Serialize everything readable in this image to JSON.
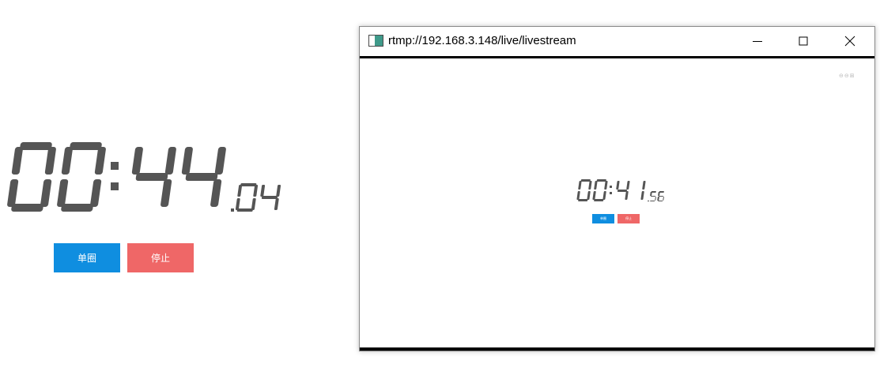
{
  "main_clock": {
    "minutes": "00",
    "seconds": "44",
    "hundredths": "04"
  },
  "buttons": {
    "lap_label": "单圈",
    "stop_label": "停止"
  },
  "player_window": {
    "title": "rtmp://192.168.3.148/live/livestream",
    "controls": [
      "minimize-icon",
      "maximize-icon",
      "close-icon"
    ],
    "stream_clock": {
      "minutes": "00",
      "seconds": "41",
      "hundredths": "56"
    },
    "stream_buttons": {
      "lap_label": "单圈",
      "stop_label": "停止"
    },
    "overlay_icons": "⊖⊖⊞"
  },
  "colors": {
    "digit": "#555555",
    "lap_button": "#0f8ee0",
    "stop_button": "#ef6767"
  }
}
